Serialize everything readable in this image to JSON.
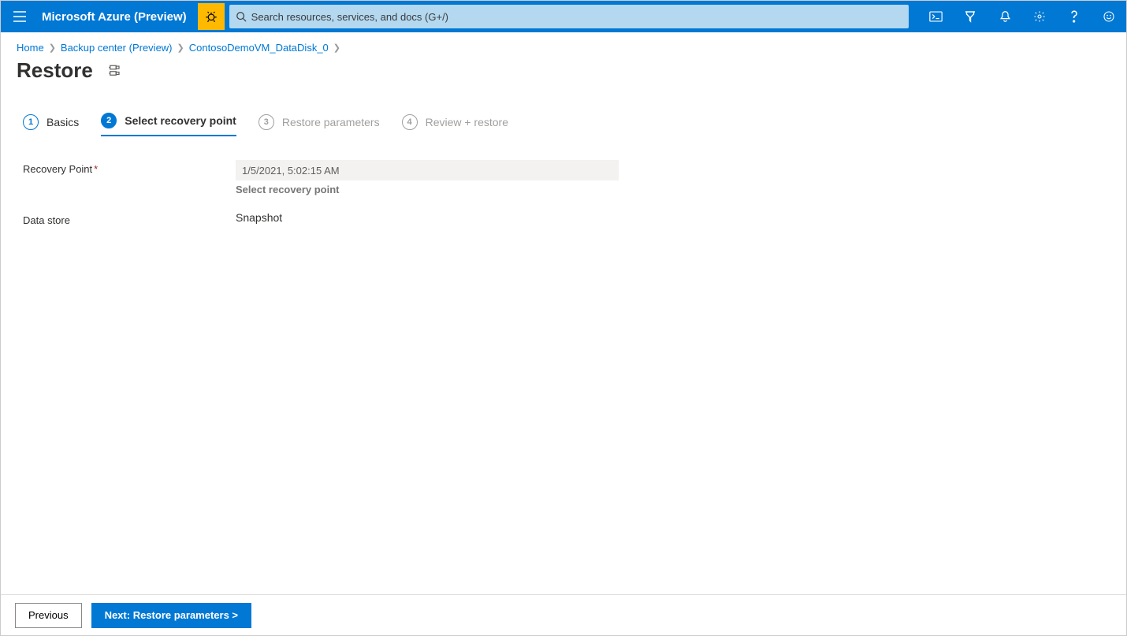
{
  "header": {
    "brand": "Microsoft Azure (Preview)",
    "search_placeholder": "Search resources, services, and docs (G+/)"
  },
  "breadcrumbs": {
    "items": [
      "Home",
      "Backup center (Preview)",
      "ContosoDemoVM_DataDisk_0"
    ]
  },
  "page": {
    "title": "Restore"
  },
  "tabs": [
    {
      "num": "1",
      "label": "Basics",
      "state": "done"
    },
    {
      "num": "2",
      "label": "Select recovery point",
      "state": "active"
    },
    {
      "num": "3",
      "label": "Restore parameters",
      "state": "disabled"
    },
    {
      "num": "4",
      "label": "Review + restore",
      "state": "disabled"
    }
  ],
  "form": {
    "recovery_point_label": "Recovery Point",
    "recovery_point_value": "1/5/2021, 5:02:15 AM",
    "select_recovery_link": "Select recovery point",
    "data_store_label": "Data store",
    "data_store_value": "Snapshot"
  },
  "footer": {
    "previous": "Previous",
    "next": "Next: Restore parameters >"
  }
}
